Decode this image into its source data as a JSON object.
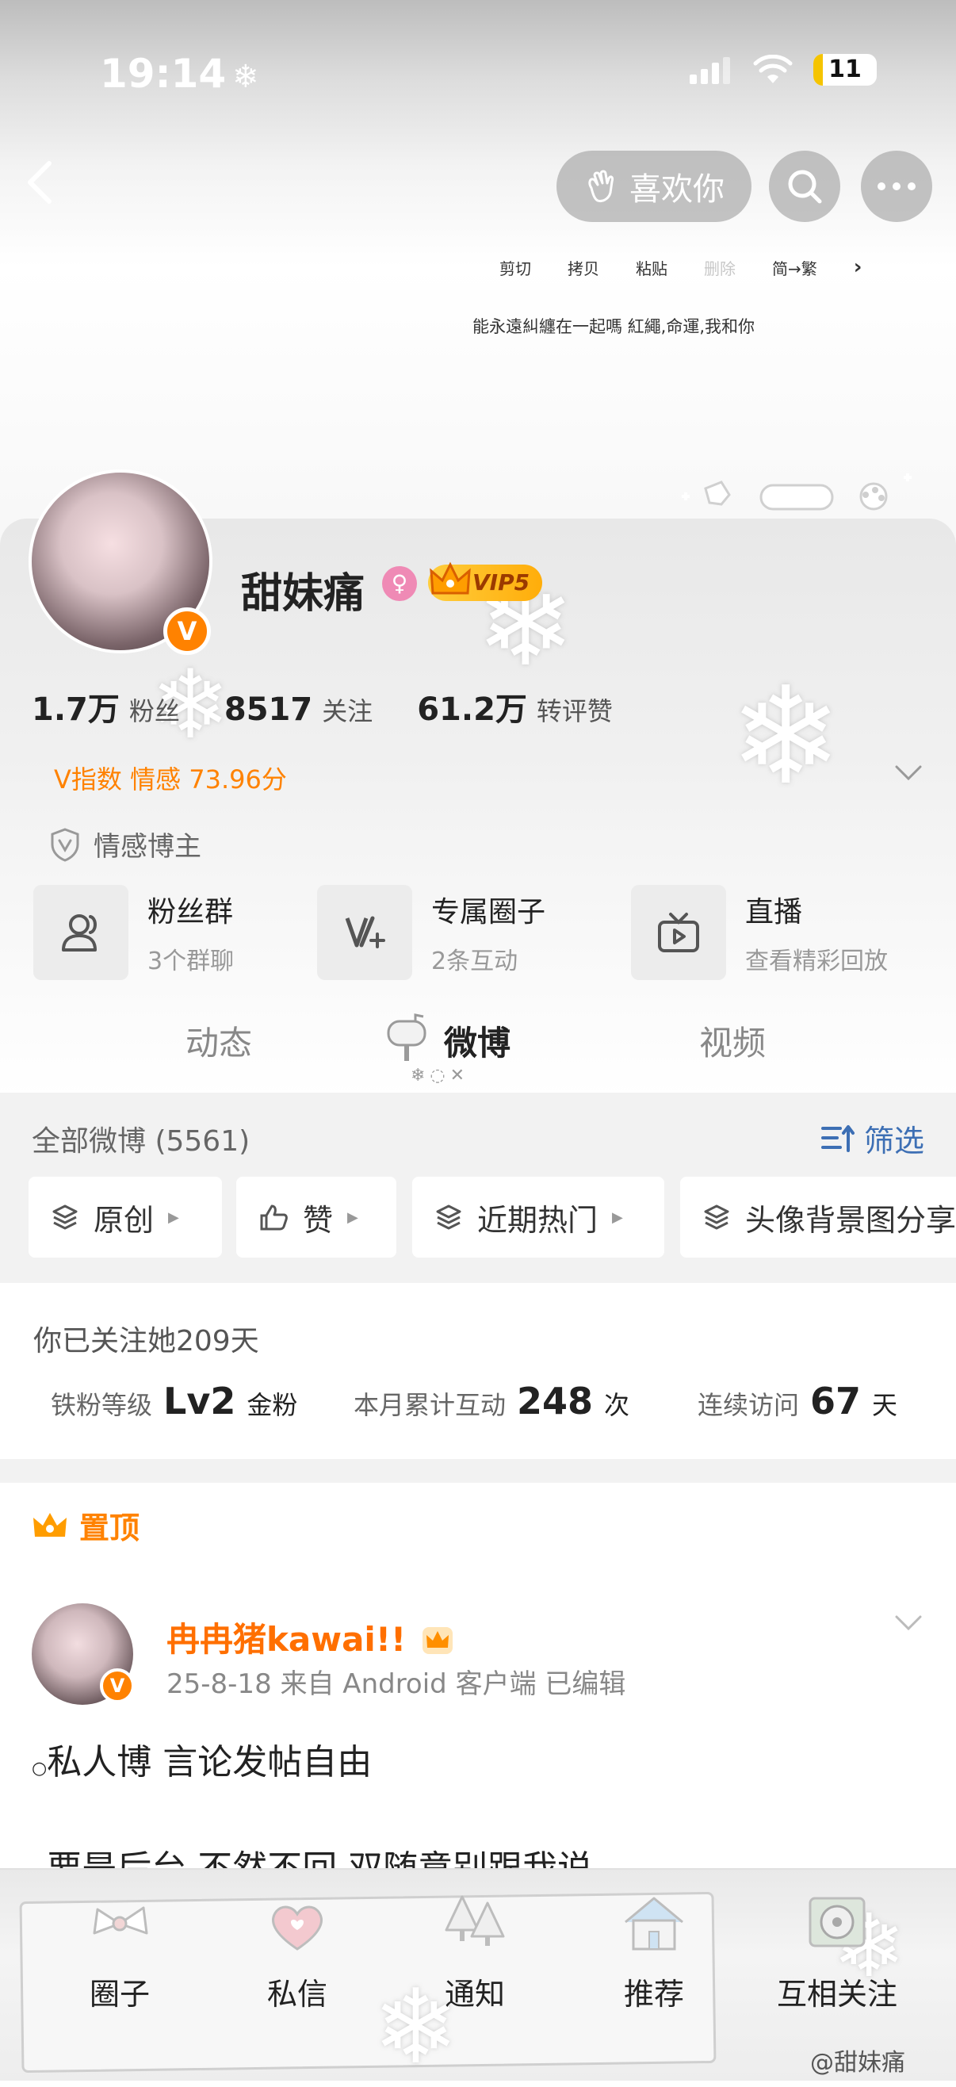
{
  "status_bar": {
    "time": "19:14",
    "battery": "11"
  },
  "header": {
    "like_label": "喜欢你",
    "edit_menu": [
      "剪切",
      "拷贝",
      "粘贴",
      "删除",
      "简→繁"
    ],
    "bio": "能永遠糾纏在一起嗎  紅繩,命運,我和你"
  },
  "profile": {
    "name": "甜妹痛",
    "vip": "VIP5",
    "stats": [
      {
        "num": "1.7万",
        "label": "粉丝"
      },
      {
        "num": "8517",
        "label": "关注"
      },
      {
        "num": "61.2万",
        "label": "转评赞"
      }
    ],
    "v_index": "V指数 情感 73.96分",
    "tag": "情感博主"
  },
  "features": [
    {
      "title": "粉丝群",
      "sub": "3个群聊",
      "icon": "fan-group-icon"
    },
    {
      "title": "专属圈子",
      "sub": "2条互动",
      "icon": "circle-icon"
    },
    {
      "title": "直播",
      "sub": "查看精彩回放",
      "icon": "live-tv-icon"
    }
  ],
  "tabs": [
    "动态",
    "微博",
    "视频"
  ],
  "filter": {
    "all_label": "全部微博 (5561)",
    "filter_label": "筛选",
    "chips": [
      "原创",
      "赞",
      "近期热门",
      "头像背景图分享"
    ]
  },
  "fan_info": {
    "follow_days": "你已关注她209天",
    "level_label": "铁粉等级",
    "level_value": "Lv2",
    "level_unit": "金粉",
    "month_label": "本月累计互动",
    "month_value": "248",
    "month_unit": "次",
    "visit_label": "连续访问",
    "visit_value": "67",
    "visit_unit": "天"
  },
  "pinned_label": "置顶",
  "post": {
    "author": "冉冉猪kawai!!",
    "meta": "25-8-18  来自 Android 客户端  已编辑",
    "line1": "私人博 言论发帖自由",
    "line2": "要是后台 不然不回 双随意别跟我说"
  },
  "bottom_nav": [
    "圈子",
    "私信",
    "通知",
    "推荐",
    "互相关注"
  ],
  "watermark": "@甜妹痛",
  "colors": {
    "accent_orange": "#ff8200",
    "link_blue": "#3d6fb4"
  }
}
